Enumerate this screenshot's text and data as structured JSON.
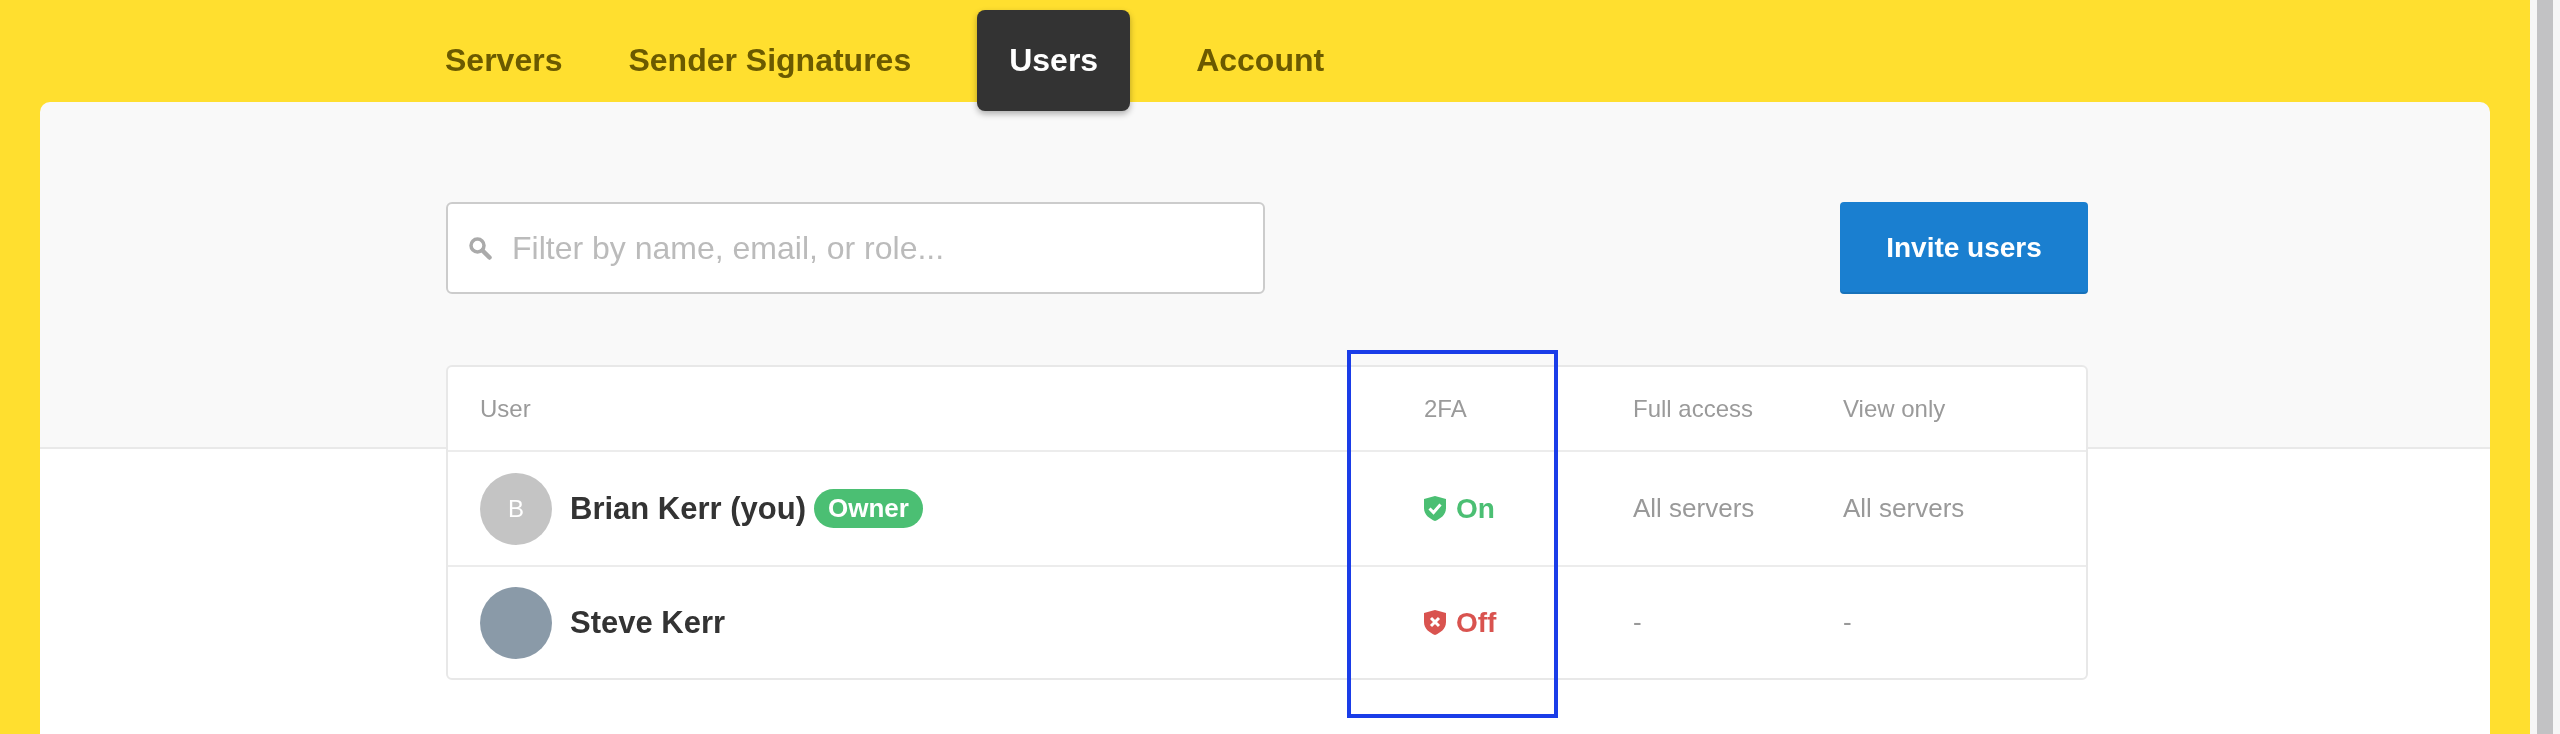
{
  "tabs": [
    {
      "label": "Servers",
      "selected": false
    },
    {
      "label": "Sender Signatures",
      "selected": false
    },
    {
      "label": "Users",
      "selected": true
    },
    {
      "label": "Account",
      "selected": false
    }
  ],
  "search": {
    "placeholder": "Filter by name, email, or role..."
  },
  "invite_button": "Invite users",
  "table": {
    "columns": [
      {
        "label": "User",
        "highlighted": false
      },
      {
        "label": "2FA",
        "highlighted": true
      },
      {
        "label": "Full access",
        "highlighted": false
      },
      {
        "label": "View only",
        "highlighted": false
      }
    ],
    "rows": [
      {
        "avatar": {
          "kind": "initial",
          "text": "B"
        },
        "name": "Brian Kerr (you)",
        "badge": "Owner",
        "two_factor": {
          "enabled": true,
          "label": "On"
        },
        "full_access": "All servers",
        "view_only": "All servers"
      },
      {
        "avatar": {
          "kind": "photo"
        },
        "name": "Steve Kerr",
        "two_factor": {
          "enabled": false,
          "label": "Off"
        },
        "full_access": "-",
        "view_only": "-"
      }
    ]
  }
}
